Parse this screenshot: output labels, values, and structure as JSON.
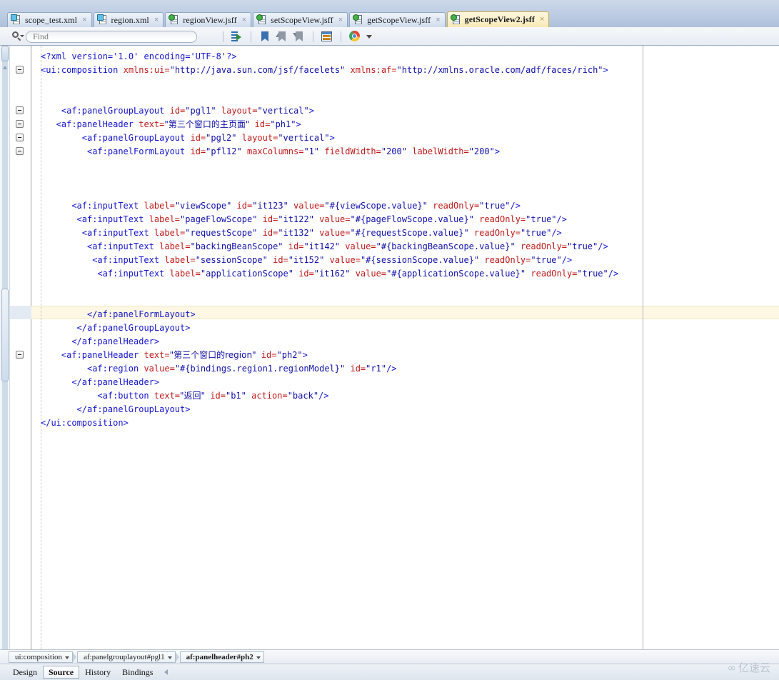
{
  "tabs": [
    {
      "label": "scope_test.xml",
      "icon": "xml-file-icon",
      "active": false,
      "close": "×"
    },
    {
      "label": "region.xml",
      "icon": "xml-file-icon",
      "active": false,
      "close": "×"
    },
    {
      "label": "regionView.jsff",
      "icon": "jsff-file-icon",
      "active": false,
      "close": "×"
    },
    {
      "label": "setScopeView.jsff",
      "icon": "jsff-file-icon",
      "active": false,
      "close": "×"
    },
    {
      "label": "getScopeView.jsff",
      "icon": "jsff-file-icon",
      "active": false,
      "close": "×"
    },
    {
      "label": "getScopeView2.jsff",
      "icon": "jsff-file-icon",
      "active": true,
      "close": "×"
    }
  ],
  "toolbar": {
    "find_placeholder": "Find",
    "find_value": "",
    "icons": [
      {
        "name": "block-indent-icon"
      },
      {
        "name": "bookmark-toggle-icon"
      },
      {
        "name": "bookmark-previous-icon"
      },
      {
        "name": "bookmark-next-icon"
      },
      {
        "name": "property-inspector-icon"
      },
      {
        "name": "preview-in-browser-icon"
      },
      {
        "name": "dropdown-caret-icon"
      }
    ]
  },
  "editor": {
    "language": "xml",
    "current_line_index": 19,
    "lines": [
      {
        "indent": 0,
        "fold": false,
        "segs": [
          {
            "c": "pi",
            "t": "<?xml version='1.0' encoding='UTF-8'?>"
          }
        ]
      },
      {
        "indent": 0,
        "fold": true,
        "segs": [
          {
            "c": "tag",
            "t": "<ui:composition "
          },
          {
            "c": "attr",
            "t": "xmlns:ui="
          },
          {
            "c": "val",
            "t": "\"http://java.sun.com/jsf/facelets\""
          },
          {
            "c": "plain",
            "t": " "
          },
          {
            "c": "attr",
            "t": "xmlns:af="
          },
          {
            "c": "val",
            "t": "\"http://xmlns.oracle.com/adf/faces/rich\""
          },
          {
            "c": "tag",
            "t": ">"
          }
        ]
      },
      {
        "indent": 0,
        "fold": false,
        "segs": []
      },
      {
        "indent": 0,
        "fold": false,
        "segs": []
      },
      {
        "indent": 4,
        "fold": true,
        "segs": [
          {
            "c": "tag",
            "t": "<af:panelGroupLayout "
          },
          {
            "c": "attr",
            "t": "id="
          },
          {
            "c": "val",
            "t": "\"pgl1\""
          },
          {
            "c": "plain",
            "t": " "
          },
          {
            "c": "attr",
            "t": "layout="
          },
          {
            "c": "val",
            "t": "\"vertical\""
          },
          {
            "c": "tag",
            "t": ">"
          }
        ]
      },
      {
        "indent": 3,
        "fold": true,
        "segs": [
          {
            "c": "tag",
            "t": "<af:panelHeader "
          },
          {
            "c": "attr",
            "t": "text="
          },
          {
            "c": "val",
            "t": "\"第三个窗口的主页面\""
          },
          {
            "c": "plain",
            "t": " "
          },
          {
            "c": "attr",
            "t": "id="
          },
          {
            "c": "val",
            "t": "\"ph1\""
          },
          {
            "c": "tag",
            "t": ">"
          }
        ]
      },
      {
        "indent": 8,
        "fold": true,
        "segs": [
          {
            "c": "tag",
            "t": "<af:panelGroupLayout "
          },
          {
            "c": "attr",
            "t": "id="
          },
          {
            "c": "val",
            "t": "\"pgl2\""
          },
          {
            "c": "plain",
            "t": " "
          },
          {
            "c": "attr",
            "t": "layout="
          },
          {
            "c": "val",
            "t": "\"vertical\""
          },
          {
            "c": "tag",
            "t": ">"
          }
        ]
      },
      {
        "indent": 9,
        "fold": true,
        "segs": [
          {
            "c": "tag",
            "t": "<af:panelFormLayout "
          },
          {
            "c": "attr",
            "t": "id="
          },
          {
            "c": "val",
            "t": "\"pfl12\""
          },
          {
            "c": "plain",
            "t": " "
          },
          {
            "c": "attr",
            "t": "maxColumns="
          },
          {
            "c": "val",
            "t": "\"1\""
          },
          {
            "c": "plain",
            "t": " "
          },
          {
            "c": "attr",
            "t": "fieldWidth="
          },
          {
            "c": "val",
            "t": "\"200\""
          },
          {
            "c": "plain",
            "t": " "
          },
          {
            "c": "attr",
            "t": "labelWidth="
          },
          {
            "c": "val",
            "t": "\"200\""
          },
          {
            "c": "tag",
            "t": ">"
          }
        ]
      },
      {
        "indent": 0,
        "fold": false,
        "segs": []
      },
      {
        "indent": 0,
        "fold": false,
        "segs": []
      },
      {
        "indent": 0,
        "fold": false,
        "segs": []
      },
      {
        "indent": 6,
        "fold": false,
        "segs": [
          {
            "c": "tag",
            "t": "<af:inputText "
          },
          {
            "c": "attr",
            "t": "label="
          },
          {
            "c": "val",
            "t": "\"viewScope\""
          },
          {
            "c": "plain",
            "t": " "
          },
          {
            "c": "attr",
            "t": "id="
          },
          {
            "c": "val",
            "t": "\"it123\""
          },
          {
            "c": "plain",
            "t": " "
          },
          {
            "c": "attr",
            "t": "value="
          },
          {
            "c": "val",
            "t": "\"#{viewScope.value}\""
          },
          {
            "c": "plain",
            "t": " "
          },
          {
            "c": "attr",
            "t": "readOnly="
          },
          {
            "c": "val",
            "t": "\"true\""
          },
          {
            "c": "tag",
            "t": "/>"
          }
        ]
      },
      {
        "indent": 7,
        "fold": false,
        "segs": [
          {
            "c": "tag",
            "t": "<af:inputText "
          },
          {
            "c": "attr",
            "t": "label="
          },
          {
            "c": "val",
            "t": "\"pageFlowScope\""
          },
          {
            "c": "plain",
            "t": " "
          },
          {
            "c": "attr",
            "t": "id="
          },
          {
            "c": "val",
            "t": "\"it122\""
          },
          {
            "c": "plain",
            "t": " "
          },
          {
            "c": "attr",
            "t": "value="
          },
          {
            "c": "val",
            "t": "\"#{pageFlowScope.value}\""
          },
          {
            "c": "plain",
            "t": " "
          },
          {
            "c": "attr",
            "t": "readOnly="
          },
          {
            "c": "val",
            "t": "\"true\""
          },
          {
            "c": "tag",
            "t": "/>"
          }
        ]
      },
      {
        "indent": 8,
        "fold": false,
        "segs": [
          {
            "c": "tag",
            "t": "<af:inputText "
          },
          {
            "c": "attr",
            "t": "label="
          },
          {
            "c": "val",
            "t": "\"requestScope\""
          },
          {
            "c": "plain",
            "t": " "
          },
          {
            "c": "attr",
            "t": "id="
          },
          {
            "c": "val",
            "t": "\"it132\""
          },
          {
            "c": "plain",
            "t": " "
          },
          {
            "c": "attr",
            "t": "value="
          },
          {
            "c": "val",
            "t": "\"#{requestScope.value}\""
          },
          {
            "c": "plain",
            "t": " "
          },
          {
            "c": "attr",
            "t": "readOnly="
          },
          {
            "c": "val",
            "t": "\"true\""
          },
          {
            "c": "tag",
            "t": "/>"
          }
        ]
      },
      {
        "indent": 9,
        "fold": false,
        "segs": [
          {
            "c": "tag",
            "t": "<af:inputText "
          },
          {
            "c": "attr",
            "t": "label="
          },
          {
            "c": "val",
            "t": "\"backingBeanScope\""
          },
          {
            "c": "plain",
            "t": " "
          },
          {
            "c": "attr",
            "t": "id="
          },
          {
            "c": "val",
            "t": "\"it142\""
          },
          {
            "c": "plain",
            "t": " "
          },
          {
            "c": "attr",
            "t": "value="
          },
          {
            "c": "val",
            "t": "\"#{backingBeanScope.value}\""
          },
          {
            "c": "plain",
            "t": " "
          },
          {
            "c": "attr",
            "t": "readOnly="
          },
          {
            "c": "val",
            "t": "\"true\""
          },
          {
            "c": "tag",
            "t": "/>"
          }
        ]
      },
      {
        "indent": 10,
        "fold": false,
        "segs": [
          {
            "c": "tag",
            "t": "<af:inputText "
          },
          {
            "c": "attr",
            "t": "label="
          },
          {
            "c": "val",
            "t": "\"sessionScope\""
          },
          {
            "c": "plain",
            "t": " "
          },
          {
            "c": "attr",
            "t": "id="
          },
          {
            "c": "val",
            "t": "\"it152\""
          },
          {
            "c": "plain",
            "t": " "
          },
          {
            "c": "attr",
            "t": "value="
          },
          {
            "c": "val",
            "t": "\"#{sessionScope.value}\""
          },
          {
            "c": "plain",
            "t": " "
          },
          {
            "c": "attr",
            "t": "readOnly="
          },
          {
            "c": "val",
            "t": "\"true\""
          },
          {
            "c": "tag",
            "t": "/>"
          }
        ]
      },
      {
        "indent": 11,
        "fold": false,
        "segs": [
          {
            "c": "tag",
            "t": "<af:inputText "
          },
          {
            "c": "attr",
            "t": "label="
          },
          {
            "c": "val",
            "t": "\"applicationScope\""
          },
          {
            "c": "plain",
            "t": " "
          },
          {
            "c": "attr",
            "t": "id="
          },
          {
            "c": "val",
            "t": "\"it162\""
          },
          {
            "c": "plain",
            "t": " "
          },
          {
            "c": "attr",
            "t": "value="
          },
          {
            "c": "val",
            "t": "\"#{applicationScope.value}\""
          },
          {
            "c": "plain",
            "t": " "
          },
          {
            "c": "attr",
            "t": "readOnly="
          },
          {
            "c": "val",
            "t": "\"true\""
          },
          {
            "c": "tag",
            "t": "/>"
          }
        ]
      },
      {
        "indent": 0,
        "fold": false,
        "segs": []
      },
      {
        "indent": 0,
        "fold": false,
        "segs": []
      },
      {
        "indent": 9,
        "fold": false,
        "segs": [
          {
            "c": "tag",
            "t": "</af:panelFormLayout>"
          }
        ]
      },
      {
        "indent": 7,
        "fold": false,
        "segs": [
          {
            "c": "tag",
            "t": "</af:panelGroupLayout>"
          }
        ]
      },
      {
        "indent": 6,
        "fold": false,
        "segs": [
          {
            "c": "tag",
            "t": "</af:panelHeader>"
          }
        ]
      },
      {
        "indent": 4,
        "fold": true,
        "segs": [
          {
            "c": "tag",
            "t": "<af:panelHeader "
          },
          {
            "c": "attr",
            "t": "text="
          },
          {
            "c": "val",
            "t": "\"第三个窗口的region\""
          },
          {
            "c": "plain",
            "t": " "
          },
          {
            "c": "attr",
            "t": "id="
          },
          {
            "c": "val",
            "t": "\"ph2\""
          },
          {
            "c": "tag",
            "t": ">"
          }
        ]
      },
      {
        "indent": 9,
        "fold": false,
        "segs": [
          {
            "c": "tag",
            "t": "<af:region "
          },
          {
            "c": "attr",
            "t": "value="
          },
          {
            "c": "val",
            "t": "\"#{bindings.region1.regionModel}\""
          },
          {
            "c": "plain",
            "t": " "
          },
          {
            "c": "attr",
            "t": "id="
          },
          {
            "c": "val",
            "t": "\"r1\""
          },
          {
            "c": "tag",
            "t": "/>"
          }
        ]
      },
      {
        "indent": 6,
        "fold": false,
        "segs": [
          {
            "c": "tag",
            "t": "</af:panelHeader>"
          }
        ]
      },
      {
        "indent": 11,
        "fold": false,
        "segs": [
          {
            "c": "tag",
            "t": "<af:button "
          },
          {
            "c": "attr",
            "t": "text="
          },
          {
            "c": "val",
            "t": "\"返回\""
          },
          {
            "c": "plain",
            "t": " "
          },
          {
            "c": "attr",
            "t": "id="
          },
          {
            "c": "val",
            "t": "\"b1\""
          },
          {
            "c": "plain",
            "t": " "
          },
          {
            "c": "attr",
            "t": "action="
          },
          {
            "c": "val",
            "t": "\"back\""
          },
          {
            "c": "tag",
            "t": "/>"
          }
        ]
      },
      {
        "indent": 7,
        "fold": false,
        "segs": [
          {
            "c": "tag",
            "t": "</af:panelGroupLayout>"
          }
        ]
      },
      {
        "indent": 0,
        "fold": false,
        "segs": [
          {
            "c": "tag",
            "t": "</ui:composition>"
          }
        ]
      }
    ]
  },
  "breadcrumbs": [
    {
      "label": "ui:composition",
      "bold": false
    },
    {
      "label": "af:panelgrouplayout#pgl1",
      "bold": false
    },
    {
      "label": "af:panelheader#ph2",
      "bold": true
    }
  ],
  "bottom_tabs": [
    {
      "label": "Design",
      "active": false
    },
    {
      "label": "Source",
      "active": true
    },
    {
      "label": "History",
      "active": false
    },
    {
      "label": "Bindings",
      "active": false
    }
  ],
  "watermark": {
    "text": "亿速云",
    "glyph": "∞"
  },
  "colors": {
    "tag": "#1414cc",
    "attr": "#c01818",
    "value": "#0f0fa8",
    "active_tab": "#fbf0c8",
    "current_line": "#fdf7e3",
    "chrome": "#aec1db"
  }
}
